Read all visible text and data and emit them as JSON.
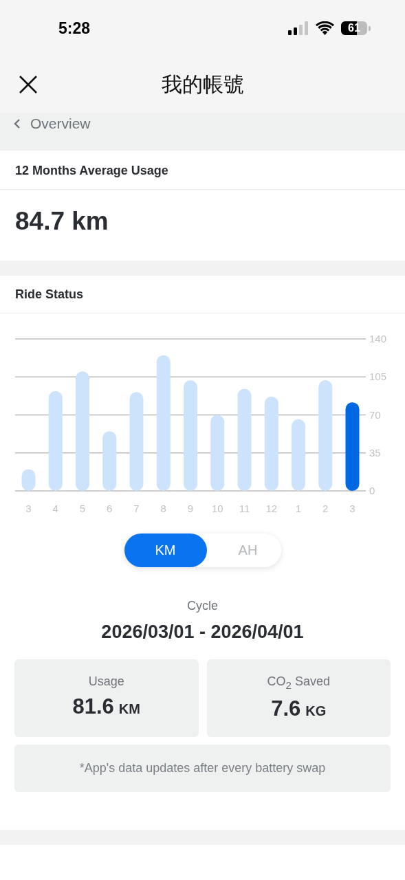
{
  "status_bar": {
    "time": "5:28",
    "battery": "61"
  },
  "header": {
    "title": "我的帳號"
  },
  "breadcrumb": {
    "label": "Overview"
  },
  "average": {
    "title": "12 Months Average Usage",
    "value": "84.7 km"
  },
  "ride_status": {
    "title": "Ride Status",
    "chart_data": {
      "type": "bar",
      "categories": [
        "3",
        "4",
        "5",
        "6",
        "7",
        "8",
        "9",
        "10",
        "11",
        "12",
        "1",
        "2",
        "3"
      ],
      "grid": true,
      "ylim": [
        0,
        140
      ],
      "yticks": [
        0,
        35,
        70,
        105,
        140
      ],
      "values": [
        20,
        92,
        110,
        55,
        91,
        125,
        102,
        70,
        94,
        87,
        66,
        102,
        81.6
      ],
      "colors": [
        "#cce3fb",
        "#cce3fb",
        "#cce3fb",
        "#cce3fb",
        "#cce3fb",
        "#cce3fb",
        "#cce3fb",
        "#cce3fb",
        "#cce3fb",
        "#cce3fb",
        "#cce3fb",
        "#cce3fb",
        "#0067e3"
      ]
    },
    "units": [
      {
        "label": "KM",
        "selected": true
      },
      {
        "label": "AH",
        "selected": false
      }
    ],
    "cycle_label": "Cycle",
    "cycle": "2026/03/01 - 2026/04/01",
    "stats": [
      {
        "label": "Usage",
        "value": "81.6",
        "unit": "KM"
      },
      {
        "label": "CO$_{2}$ Saved",
        "value": "7.6",
        "unit": "KG"
      }
    ],
    "note": "*App's data updates after every battery swap"
  }
}
